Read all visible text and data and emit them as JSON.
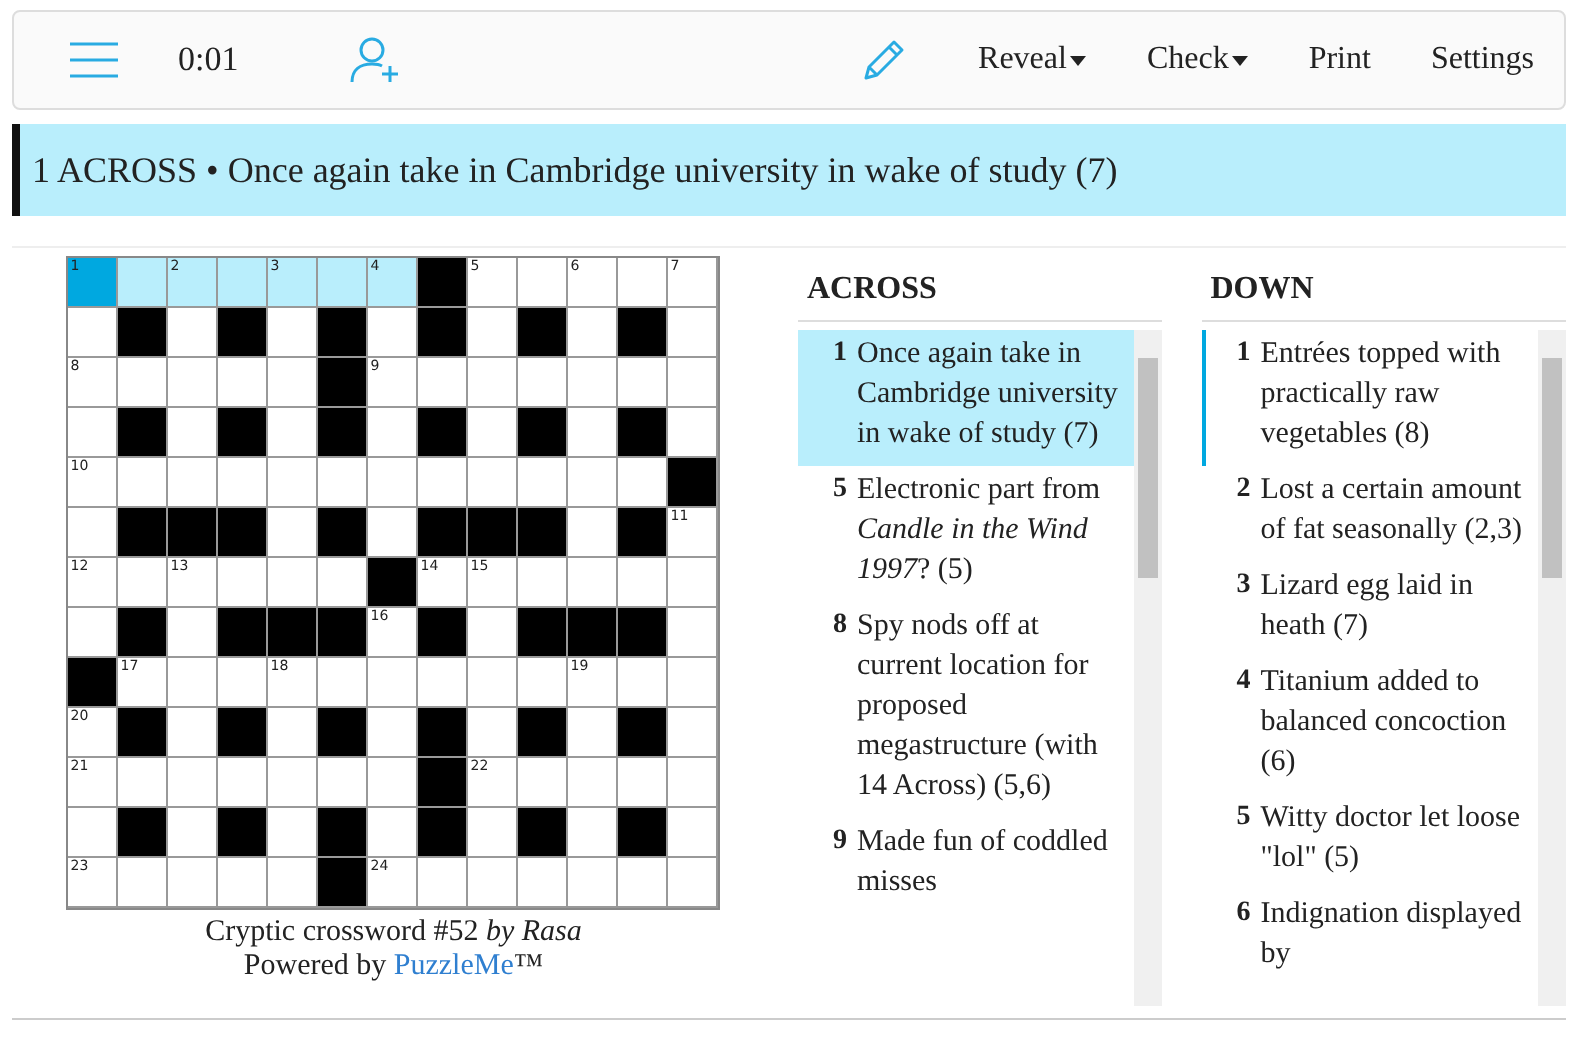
{
  "toolbar": {
    "timer": "0:01",
    "items": [
      {
        "label": "Reveal",
        "dropdown": true
      },
      {
        "label": "Check",
        "dropdown": true
      },
      {
        "label": "Print",
        "dropdown": false
      },
      {
        "label": "Settings",
        "dropdown": false
      }
    ]
  },
  "current_clue": {
    "number": "1",
    "direction": "ACROSS",
    "separator": "•",
    "text": "Once again take in Cambridge university in wake of study (7)"
  },
  "grid": {
    "rows": [
      [
        {
          "black": false,
          "number": "1",
          "selected": true,
          "highlighted": true
        },
        {
          "black": false,
          "selected": false,
          "highlighted": true
        },
        {
          "black": false,
          "number": "2",
          "selected": false,
          "highlighted": true
        },
        {
          "black": false,
          "selected": false,
          "highlighted": true
        },
        {
          "black": false,
          "number": "3",
          "selected": false,
          "highlighted": true
        },
        {
          "black": false,
          "selected": false,
          "highlighted": true
        },
        {
          "black": false,
          "number": "4",
          "selected": false,
          "highlighted": true
        },
        {
          "black": true
        },
        {
          "black": false,
          "number": "5",
          "selected": false,
          "highlighted": false
        },
        {
          "black": false,
          "selected": false,
          "highlighted": false
        },
        {
          "black": false,
          "number": "6",
          "selected": false,
          "highlighted": false
        },
        {
          "black": false,
          "selected": false,
          "highlighted": false
        },
        {
          "black": false,
          "number": "7",
          "selected": false,
          "highlighted": false
        }
      ],
      [
        {
          "black": false,
          "selected": false,
          "highlighted": false
        },
        {
          "black": true
        },
        {
          "black": false,
          "selected": false,
          "highlighted": false
        },
        {
          "black": true
        },
        {
          "black": false,
          "selected": false,
          "highlighted": false
        },
        {
          "black": true
        },
        {
          "black": false,
          "selected": false,
          "highlighted": false
        },
        {
          "black": true
        },
        {
          "black": false,
          "selected": false,
          "highlighted": false
        },
        {
          "black": true
        },
        {
          "black": false,
          "selected": false,
          "highlighted": false
        },
        {
          "black": true
        },
        {
          "black": false,
          "selected": false,
          "highlighted": false
        }
      ],
      [
        {
          "black": false,
          "number": "8",
          "selected": false,
          "highlighted": false
        },
        {
          "black": false,
          "selected": false,
          "highlighted": false
        },
        {
          "black": false,
          "selected": false,
          "highlighted": false
        },
        {
          "black": false,
          "selected": false,
          "highlighted": false
        },
        {
          "black": false,
          "selected": false,
          "highlighted": false
        },
        {
          "black": true
        },
        {
          "black": false,
          "number": "9",
          "selected": false,
          "highlighted": false
        },
        {
          "black": false,
          "selected": false,
          "highlighted": false
        },
        {
          "black": false,
          "selected": false,
          "highlighted": false
        },
        {
          "black": false,
          "selected": false,
          "highlighted": false
        },
        {
          "black": false,
          "selected": false,
          "highlighted": false
        },
        {
          "black": false,
          "selected": false,
          "highlighted": false
        },
        {
          "black": false,
          "selected": false,
          "highlighted": false
        }
      ],
      [
        {
          "black": false,
          "selected": false,
          "highlighted": false
        },
        {
          "black": true
        },
        {
          "black": false,
          "selected": false,
          "highlighted": false
        },
        {
          "black": true
        },
        {
          "black": false,
          "selected": false,
          "highlighted": false
        },
        {
          "black": true
        },
        {
          "black": false,
          "selected": false,
          "highlighted": false
        },
        {
          "black": true
        },
        {
          "black": false,
          "selected": false,
          "highlighted": false
        },
        {
          "black": true
        },
        {
          "black": false,
          "selected": false,
          "highlighted": false
        },
        {
          "black": true
        },
        {
          "black": false,
          "selected": false,
          "highlighted": false
        }
      ],
      [
        {
          "black": false,
          "number": "10",
          "selected": false,
          "highlighted": false
        },
        {
          "black": false,
          "selected": false,
          "highlighted": false
        },
        {
          "black": false,
          "selected": false,
          "highlighted": false
        },
        {
          "black": false,
          "selected": false,
          "highlighted": false
        },
        {
          "black": false,
          "selected": false,
          "highlighted": false
        },
        {
          "black": false,
          "selected": false,
          "highlighted": false
        },
        {
          "black": false,
          "selected": false,
          "highlighted": false
        },
        {
          "black": false,
          "selected": false,
          "highlighted": false
        },
        {
          "black": false,
          "selected": false,
          "highlighted": false
        },
        {
          "black": false,
          "selected": false,
          "highlighted": false
        },
        {
          "black": false,
          "selected": false,
          "highlighted": false
        },
        {
          "black": false,
          "selected": false,
          "highlighted": false
        },
        {
          "black": true
        }
      ],
      [
        {
          "black": false,
          "selected": false,
          "highlighted": false
        },
        {
          "black": true
        },
        {
          "black": true
        },
        {
          "black": true
        },
        {
          "black": false,
          "selected": false,
          "highlighted": false
        },
        {
          "black": true
        },
        {
          "black": false,
          "selected": false,
          "highlighted": false
        },
        {
          "black": true
        },
        {
          "black": true
        },
        {
          "black": true
        },
        {
          "black": false,
          "selected": false,
          "highlighted": false
        },
        {
          "black": true
        },
        {
          "black": false,
          "number": "11",
          "selected": false,
          "highlighted": false
        }
      ],
      [
        {
          "black": false,
          "number": "12",
          "selected": false,
          "highlighted": false
        },
        {
          "black": false,
          "selected": false,
          "highlighted": false
        },
        {
          "black": false,
          "number": "13",
          "selected": false,
          "highlighted": false
        },
        {
          "black": false,
          "selected": false,
          "highlighted": false
        },
        {
          "black": false,
          "selected": false,
          "highlighted": false
        },
        {
          "black": false,
          "selected": false,
          "highlighted": false
        },
        {
          "black": true
        },
        {
          "black": false,
          "number": "14",
          "selected": false,
          "highlighted": false
        },
        {
          "black": false,
          "number": "15",
          "selected": false,
          "highlighted": false
        },
        {
          "black": false,
          "selected": false,
          "highlighted": false
        },
        {
          "black": false,
          "selected": false,
          "highlighted": false
        },
        {
          "black": false,
          "selected": false,
          "highlighted": false
        },
        {
          "black": false,
          "selected": false,
          "highlighted": false
        }
      ],
      [
        {
          "black": false,
          "selected": false,
          "highlighted": false
        },
        {
          "black": true
        },
        {
          "black": false,
          "selected": false,
          "highlighted": false
        },
        {
          "black": true
        },
        {
          "black": true
        },
        {
          "black": true
        },
        {
          "black": false,
          "number": "16",
          "selected": false,
          "highlighted": false
        },
        {
          "black": true
        },
        {
          "black": false,
          "selected": false,
          "highlighted": false
        },
        {
          "black": true
        },
        {
          "black": true
        },
        {
          "black": true
        },
        {
          "black": false,
          "selected": false,
          "highlighted": false
        }
      ],
      [
        {
          "black": true
        },
        {
          "black": false,
          "number": "17",
          "selected": false,
          "highlighted": false
        },
        {
          "black": false,
          "selected": false,
          "highlighted": false
        },
        {
          "black": false,
          "selected": false,
          "highlighted": false
        },
        {
          "black": false,
          "number": "18",
          "selected": false,
          "highlighted": false
        },
        {
          "black": false,
          "selected": false,
          "highlighted": false
        },
        {
          "black": false,
          "selected": false,
          "highlighted": false
        },
        {
          "black": false,
          "selected": false,
          "highlighted": false
        },
        {
          "black": false,
          "selected": false,
          "highlighted": false
        },
        {
          "black": false,
          "selected": false,
          "highlighted": false
        },
        {
          "black": false,
          "number": "19",
          "selected": false,
          "highlighted": false
        },
        {
          "black": false,
          "selected": false,
          "highlighted": false
        },
        {
          "black": false,
          "selected": false,
          "highlighted": false
        }
      ],
      [
        {
          "black": false,
          "number": "20",
          "selected": false,
          "highlighted": false
        },
        {
          "black": true
        },
        {
          "black": false,
          "selected": false,
          "highlighted": false
        },
        {
          "black": true
        },
        {
          "black": false,
          "selected": false,
          "highlighted": false
        },
        {
          "black": true
        },
        {
          "black": false,
          "selected": false,
          "highlighted": false
        },
        {
          "black": true
        },
        {
          "black": false,
          "selected": false,
          "highlighted": false
        },
        {
          "black": true
        },
        {
          "black": false,
          "selected": false,
          "highlighted": false
        },
        {
          "black": true
        },
        {
          "black": false,
          "selected": false,
          "highlighted": false
        }
      ],
      [
        {
          "black": false,
          "number": "21",
          "selected": false,
          "highlighted": false
        },
        {
          "black": false,
          "selected": false,
          "highlighted": false
        },
        {
          "black": false,
          "selected": false,
          "highlighted": false
        },
        {
          "black": false,
          "selected": false,
          "highlighted": false
        },
        {
          "black": false,
          "selected": false,
          "highlighted": false
        },
        {
          "black": false,
          "selected": false,
          "highlighted": false
        },
        {
          "black": false,
          "selected": false,
          "highlighted": false
        },
        {
          "black": true
        },
        {
          "black": false,
          "number": "22",
          "selected": false,
          "highlighted": false
        },
        {
          "black": false,
          "selected": false,
          "highlighted": false
        },
        {
          "black": false,
          "selected": false,
          "highlighted": false
        },
        {
          "black": false,
          "selected": false,
          "highlighted": false
        },
        {
          "black": false,
          "selected": false,
          "highlighted": false
        }
      ],
      [
        {
          "black": false,
          "selected": false,
          "highlighted": false
        },
        {
          "black": true
        },
        {
          "black": false,
          "selected": false,
          "highlighted": false
        },
        {
          "black": true
        },
        {
          "black": false,
          "selected": false,
          "highlighted": false
        },
        {
          "black": true
        },
        {
          "black": false,
          "selected": false,
          "highlighted": false
        },
        {
          "black": true
        },
        {
          "black": false,
          "selected": false,
          "highlighted": false
        },
        {
          "black": true
        },
        {
          "black": false,
          "selected": false,
          "highlighted": false
        },
        {
          "black": true
        },
        {
          "black": false,
          "selected": false,
          "highlighted": false
        }
      ],
      [
        {
          "black": false,
          "number": "23",
          "selected": false,
          "highlighted": false
        },
        {
          "black": false,
          "selected": false,
          "highlighted": false
        },
        {
          "black": false,
          "selected": false,
          "highlighted": false
        },
        {
          "black": false,
          "selected": false,
          "highlighted": false
        },
        {
          "black": false,
          "selected": false,
          "highlighted": false
        },
        {
          "black": true
        },
        {
          "black": false,
          "number": "24",
          "selected": false,
          "highlighted": false
        },
        {
          "black": false,
          "selected": false,
          "highlighted": false
        },
        {
          "black": false,
          "selected": false,
          "highlighted": false
        },
        {
          "black": false,
          "selected": false,
          "highlighted": false
        },
        {
          "black": false,
          "selected": false,
          "highlighted": false
        },
        {
          "black": false,
          "selected": false,
          "highlighted": false
        },
        {
          "black": false,
          "selected": false,
          "highlighted": false
        }
      ]
    ]
  },
  "caption": {
    "title": "Cryptic crossword #52 *by Rasa*",
    "powered_by": "Powered by",
    "link": "PuzzleMe",
    "trademark": "™"
  },
  "across": {
    "heading": "ACROSS",
    "clues": [
      {
        "number": "1",
        "text": "Once again take in Cambridge university in wake of study (7)",
        "selected": true
      },
      {
        "number": "5",
        "text": "Electronic part from *Candle in the Wind 1997*? (5)",
        "selected": false
      },
      {
        "number": "8",
        "text": "Spy nods off at current location for proposed megastructure (with 14 Across) (5,6)",
        "selected": false
      },
      {
        "number": "9",
        "text": "Made fun of coddled misses",
        "selected": false
      }
    ]
  },
  "down": {
    "heading": "DOWN",
    "clues": [
      {
        "number": "1",
        "text": "Entrées topped with practically raw vegetables (8)",
        "crossing": true
      },
      {
        "number": "2",
        "text": "Lost a certain amount of fat seasonally (2,3)",
        "crossing": false
      },
      {
        "number": "3",
        "text": "Lizard egg laid in heath (7)",
        "crossing": false
      },
      {
        "number": "4",
        "text": "Titanium added to balanced concoction (6)",
        "crossing": false
      },
      {
        "number": "5",
        "text": "Witty doctor let loose \"lol\" (5)",
        "crossing": false
      },
      {
        "number": "6",
        "text": "Indignation displayed by",
        "crossing": false
      }
    ]
  }
}
